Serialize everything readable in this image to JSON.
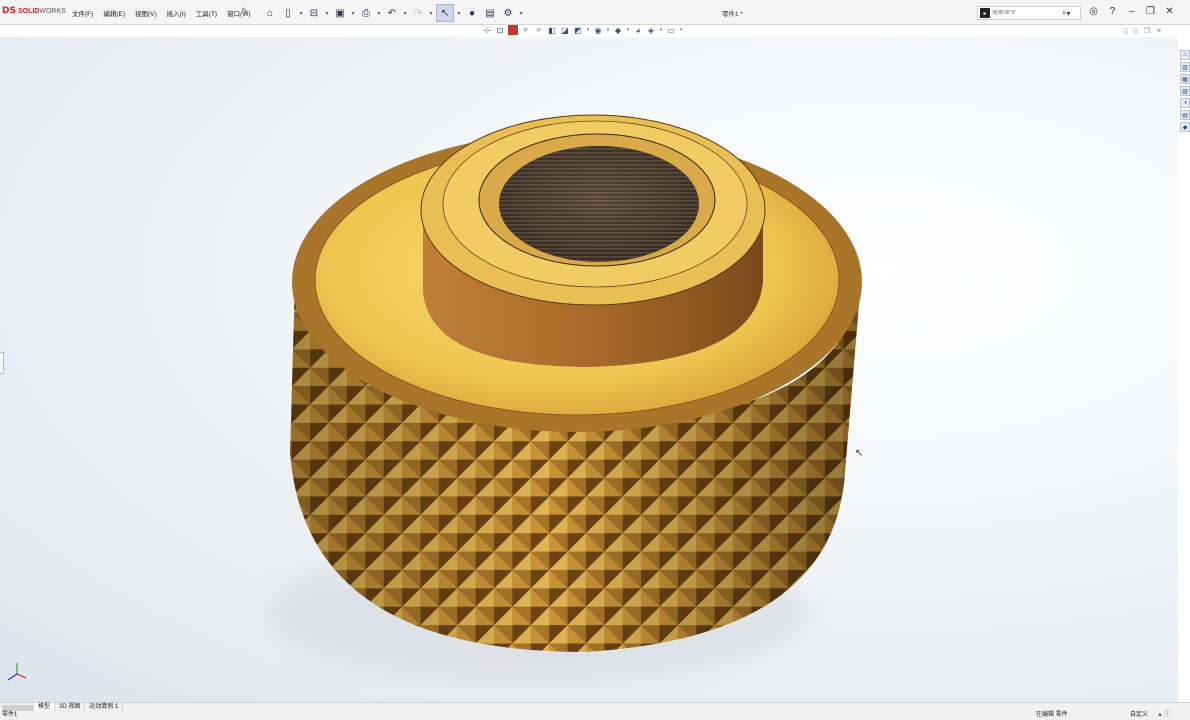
{
  "app": {
    "logo_ds": "DS",
    "logo_brand": "SOLID",
    "logo_brand2": "WORKS"
  },
  "menu": [
    "文件(F)",
    "编辑(E)",
    "视图(V)",
    "插入(I)",
    "工具(T)",
    "窗口(W)"
  ],
  "quick_access": {
    "items": [
      "home-icon",
      "new-document-icon",
      "open-icon",
      "save-icon",
      "print-icon",
      "undo-icon",
      "redo-icon",
      "select-arrow-icon",
      "rebuild-icon",
      "file-properties-icon",
      "options-gear-icon"
    ]
  },
  "document": {
    "title": "零件1 *"
  },
  "search": {
    "placeholder": "搜索命令"
  },
  "window_controls": [
    "user-icon",
    "help-icon",
    "minimize-icon",
    "restore-icon",
    "close-icon"
  ],
  "view_toolbar": [
    "zoom-to-fit-icon",
    "zoom-to-area-icon",
    "previous-view-icon",
    "section-view-icon",
    "dynamic-annotation-icon",
    "view-orientation-icon",
    "display-style-icon",
    "hide-show-items-icon",
    "edit-appearance-icon",
    "apply-scene-icon",
    "view-settings-icon"
  ],
  "task_pane": [
    "resources-icon",
    "design-library-icon",
    "file-explorer-icon",
    "view-palette-icon",
    "appearances-icon",
    "custom-properties-icon",
    "solidworks-forum-icon"
  ],
  "tabs": [
    {
      "label": "模型",
      "active": true
    },
    {
      "label": "3D 视图",
      "active": false
    },
    {
      "label": "运动算例 1",
      "active": false
    }
  ],
  "status": {
    "left": "零件1",
    "mode": "在编辑 零件",
    "units": "自定义",
    "extra": "▲ ⓘ"
  },
  "colors": {
    "accent": "#d71f1f",
    "brass_light": "#f2cc55",
    "brass_dark": "#6b4310"
  }
}
